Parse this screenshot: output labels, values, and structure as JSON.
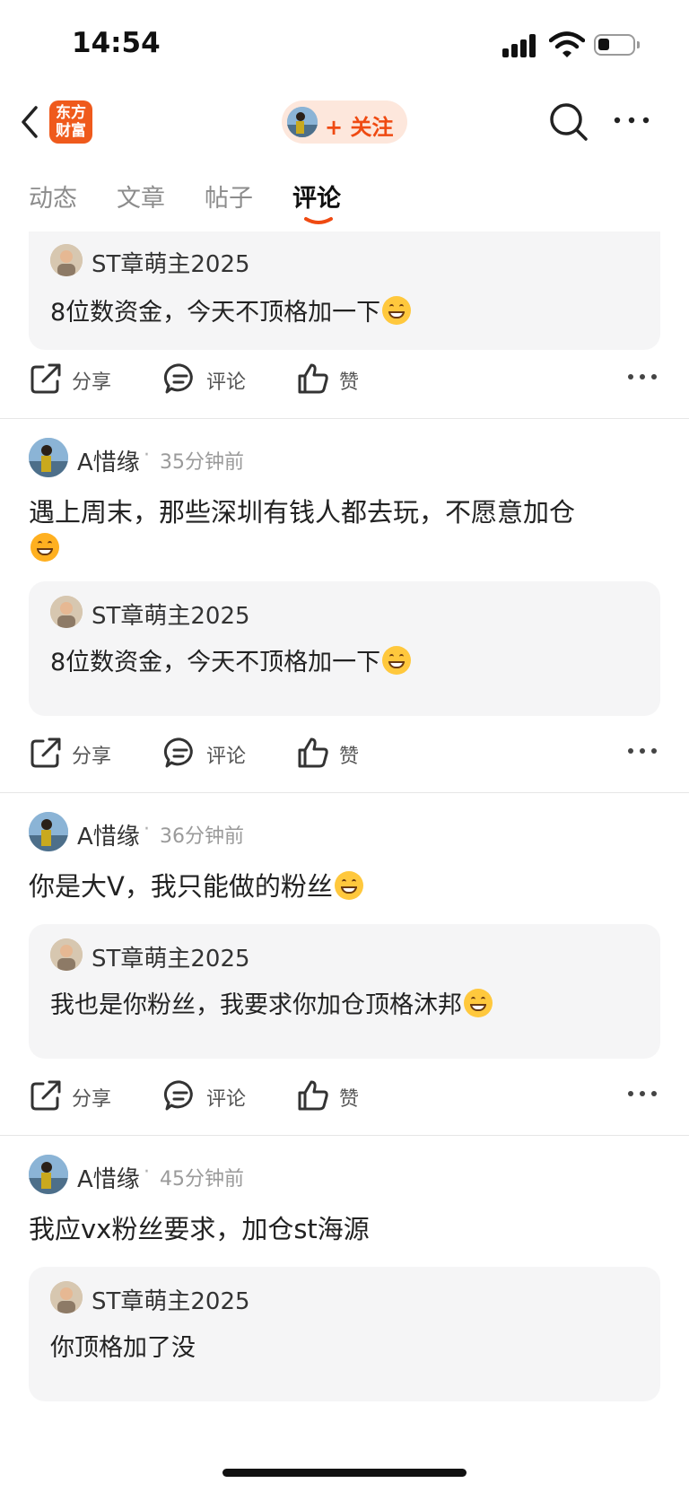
{
  "status_bar": {
    "time": "14:54"
  },
  "nav": {
    "logo_line1": "东方",
    "logo_line2": "财富",
    "follow_label": "+ 关注"
  },
  "tabs": [
    {
      "label": "动态"
    },
    {
      "label": "文章"
    },
    {
      "label": "帖子"
    },
    {
      "label": "评论",
      "active": true
    }
  ],
  "actions": {
    "share": "分享",
    "comment": "评论",
    "like": "赞"
  },
  "posts": [
    {
      "quote": {
        "user": "ST章萌主2025",
        "text": "8位数资金，今天不顶格加一下"
      }
    },
    {
      "author": "A惜缘",
      "time": "35分钟前",
      "text": "遇上周末，那些深圳有钱人都去玩，不愿意加仓",
      "quote": {
        "user": "ST章萌主2025",
        "text": "8位数资金，今天不顶格加一下"
      }
    },
    {
      "author": "A惜缘",
      "time": "36分钟前",
      "text": "你是大V，我只能做的粉丝",
      "quote": {
        "user": "ST章萌主2025",
        "text": "我也是你粉丝，我要求你加仓顶格沐邦"
      }
    },
    {
      "author": "A惜缘",
      "time": "45分钟前",
      "text": "我应vx粉丝要求，加仓st海源",
      "quote": {
        "user": "ST章萌主2025",
        "text": "你顶格加了没"
      }
    }
  ],
  "icons": {
    "back": "chevron-left-icon",
    "search": "search-icon",
    "more": "more-dots-icon",
    "share": "share-icon",
    "comment": "comment-bubble-icon",
    "like": "thumbs-up-icon"
  },
  "colors": {
    "accent": "#ef4a12",
    "logo": "#ef5a1c",
    "quote_bg": "#f5f5f6"
  }
}
